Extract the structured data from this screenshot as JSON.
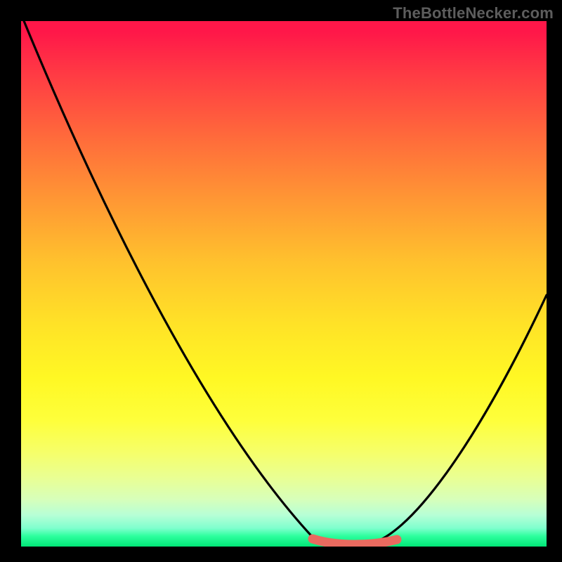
{
  "watermark": "TheBottleNecker.com",
  "chart_data": {
    "type": "line",
    "title": "",
    "xlabel": "",
    "ylabel": "",
    "x": [
      0,
      0.1,
      0.2,
      0.3,
      0.4,
      0.5,
      0.56,
      0.62,
      0.66,
      0.72,
      0.8,
      0.9,
      1.0
    ],
    "values": [
      1.0,
      0.82,
      0.64,
      0.46,
      0.28,
      0.12,
      0.03,
      0.0,
      0.0,
      0.02,
      0.12,
      0.3,
      0.48
    ],
    "ylim": [
      0,
      1
    ],
    "xlim": [
      0,
      1
    ],
    "annotations": [
      {
        "text": "TheBottleNecker.com",
        "position": "top-right"
      }
    ],
    "highlight_range_x": [
      0.56,
      0.72
    ],
    "background_gradient": {
      "orientation": "vertical",
      "stops": [
        {
          "pos": 0.0,
          "color": "#ff1749"
        },
        {
          "pos": 0.5,
          "color": "#ffd428"
        },
        {
          "pos": 0.8,
          "color": "#fdff4b"
        },
        {
          "pos": 1.0,
          "color": "#00e676"
        }
      ]
    }
  }
}
